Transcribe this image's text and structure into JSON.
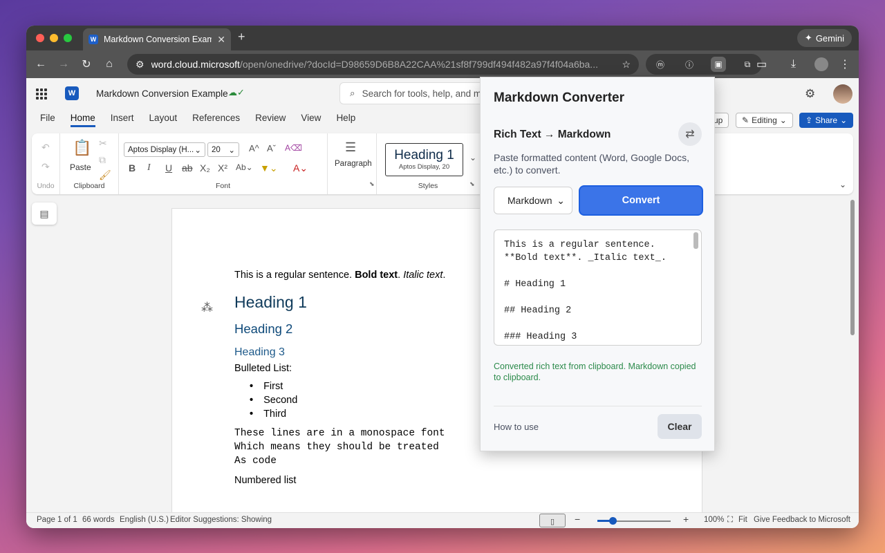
{
  "browser": {
    "tab_title": "Markdown Conversion Example",
    "tab_favicon": "W",
    "gemini_label": "Gemini",
    "url_host": "word.cloud.microsoft",
    "url_path": "/open/onedrive/?docId=D98659D6B8A22CAA%21sf8f799df494f482a97f4f04a6ba..."
  },
  "office": {
    "doc_title": "Markdown Conversion Example",
    "search_placeholder": "Search for tools, help, and m",
    "menus": [
      "File",
      "Home",
      "Insert",
      "Layout",
      "References",
      "Review",
      "View",
      "Help"
    ],
    "active_menu": "Home",
    "editing_label": "Editing",
    "share_label": "Share",
    "group_label": "up",
    "ribbon": {
      "undo_label": "Undo",
      "paste_label": "Paste",
      "clipboard_label": "Clipboard",
      "font_name": "Aptos Display (H...",
      "font_size": "20",
      "font_label": "Font",
      "paragraph_label": "Paragraph",
      "style_heading": "Heading 1",
      "style_sub": "Aptos Display, 20",
      "styles_label": "Styles"
    },
    "document": {
      "line1_regular": "This is a regular sentence. ",
      "line1_bold": "Bold text",
      "line1_sep": ". ",
      "line1_italic": "Italic text",
      "line1_end": ".",
      "h1": "Heading 1",
      "h2": "Heading 2",
      "h3": "Heading 3",
      "bulleted_label": "Bulleted List:",
      "bullets": [
        "First",
        "Second",
        "Third"
      ],
      "mono1": "These lines are in a monospace font",
      "mono2": "Which means they should be treated",
      "mono3": "As code",
      "numbered_label": "Numbered list"
    },
    "status": {
      "page": "Page 1 of 1",
      "words": "66 words",
      "language": "English (U.S.)",
      "suggestions": "Editor Suggestions: Showing",
      "zoom": "100%",
      "fit": "Fit",
      "feedback": "Give Feedback to Microsoft"
    }
  },
  "popup": {
    "title": "Markdown Converter",
    "mode": "Rich Text → Markdown",
    "description": "Paste formatted content (Word, Google Docs, etc.) to convert.",
    "format_selected": "Markdown",
    "convert_label": "Convert",
    "output_lines": [
      "This is a regular sentence.",
      "**Bold text**. _Italic text_.",
      "",
      "# Heading 1",
      "",
      "## Heading 2",
      "",
      "### Heading 3"
    ],
    "status": "Converted rich text from clipboard. Markdown copied to clipboard.",
    "howto_label": "How to use",
    "clear_label": "Clear"
  }
}
